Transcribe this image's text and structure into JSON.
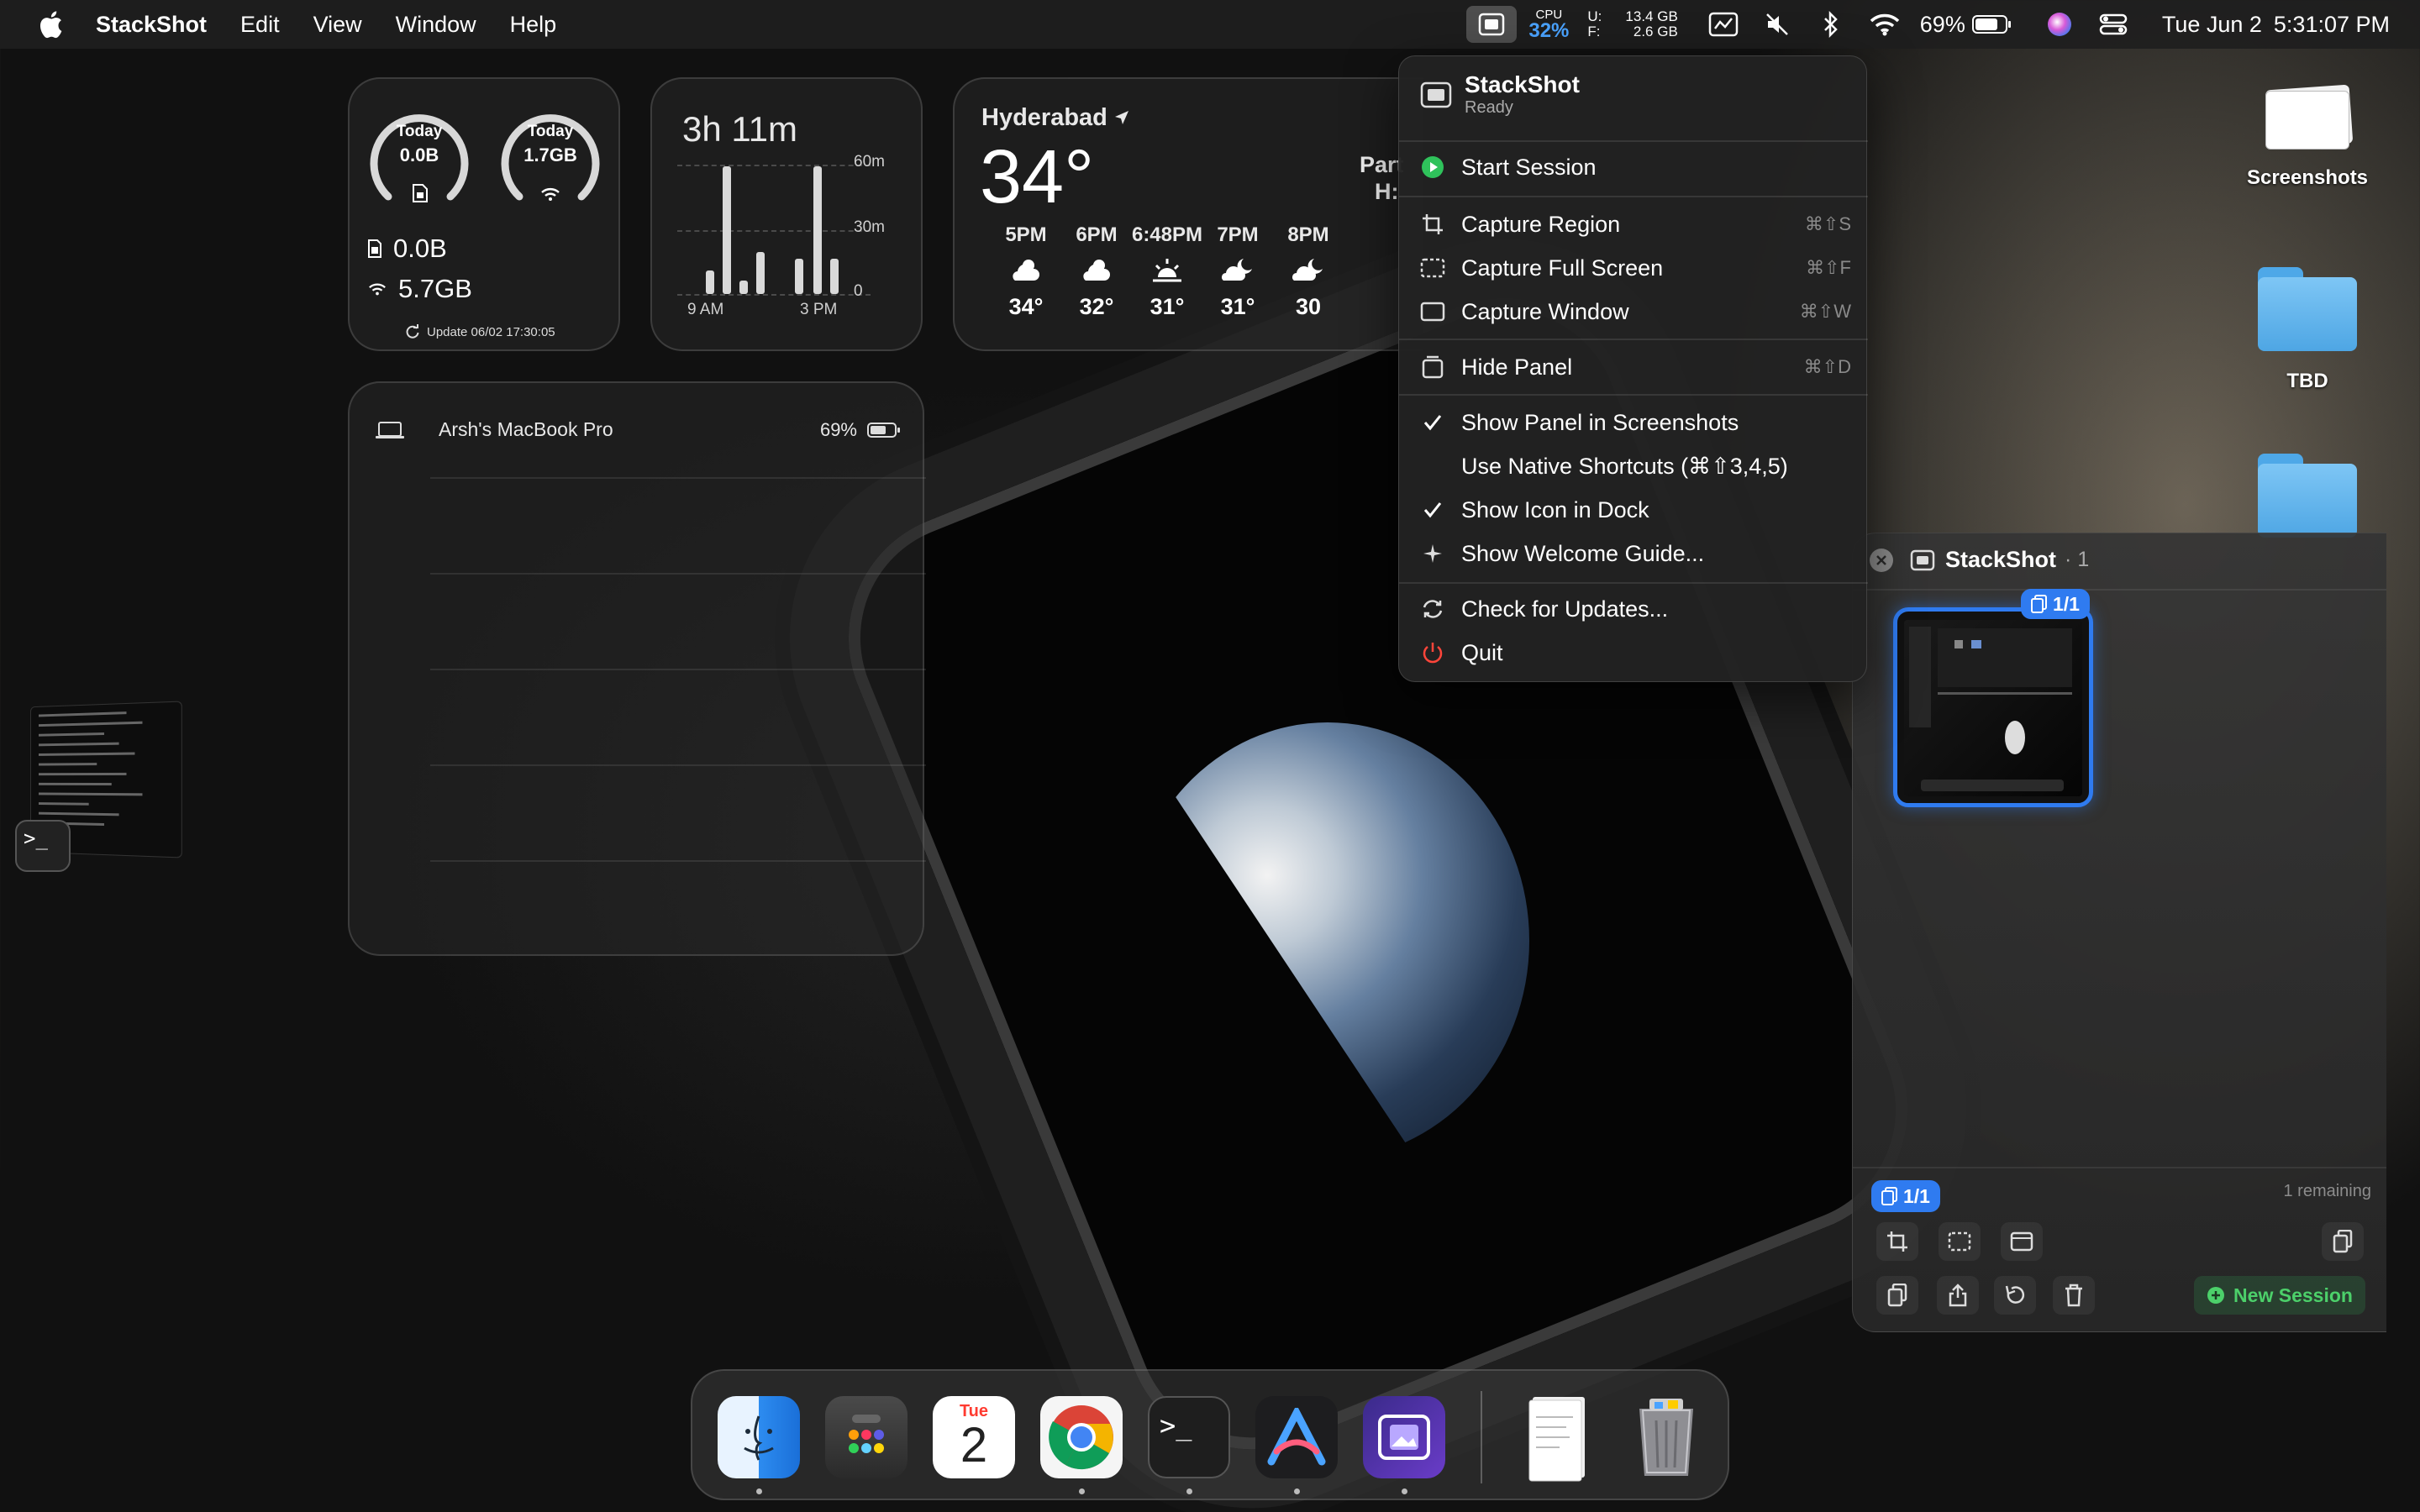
{
  "menubar": {
    "app_name": "StackShot",
    "menus": [
      "Edit",
      "View",
      "Window",
      "Help"
    ],
    "cpu_label": "CPU",
    "cpu_value": "32%",
    "mem_labels": [
      "U:",
      "F:"
    ],
    "mem_values": [
      "13.4 GB",
      "2.6 GB"
    ],
    "battery_pct": "69%",
    "date": "Tue Jun 2",
    "time": "5:31:07 PM",
    "accent": "#4aa3ff"
  },
  "widgets": {
    "data": {
      "left_ring": {
        "label": "Today",
        "value": "0.0B"
      },
      "right_ring": {
        "label": "Today",
        "value": "1.7GB"
      },
      "cellular": "0.0B",
      "wifi": "5.7GB",
      "update": "Update 06/02 17:30:05"
    },
    "screen_time": {
      "total": "3h 11m",
      "y_labels": [
        "60m",
        "30m",
        "0"
      ],
      "x_labels": [
        "9 AM",
        "3 PM"
      ]
    },
    "weather": {
      "city": "Hyderabad",
      "temp": "34°",
      "condition_line1": "Part",
      "condition_line2": "H:",
      "hours": [
        {
          "time": "5PM",
          "temp": "34°",
          "icon": "partly-sunny-icon"
        },
        {
          "time": "6PM",
          "temp": "32°",
          "icon": "partly-sunny-icon"
        },
        {
          "time": "6:48PM",
          "temp": "31°",
          "icon": "sunset-icon"
        },
        {
          "time": "7PM",
          "temp": "31°",
          "icon": "cloud-moon-icon"
        },
        {
          "time": "8PM",
          "temp": "30",
          "icon": "cloud-moon-icon"
        }
      ]
    },
    "battery": {
      "device": "Arsh's MacBook Pro",
      "pct": "69%"
    }
  },
  "desktop": {
    "items": [
      "Screenshots",
      "TBD"
    ]
  },
  "menu": {
    "title": "StackShot",
    "status": "Ready",
    "items": [
      {
        "label": "Start Session",
        "shortcut": ""
      },
      {
        "label": "Capture Region",
        "shortcut": "⌘⇧S"
      },
      {
        "label": "Capture Full Screen",
        "shortcut": "⌘⇧F"
      },
      {
        "label": "Capture Window",
        "shortcut": "⌘⇧W"
      },
      {
        "label": "Hide Panel",
        "shortcut": "⌘⇧D"
      },
      {
        "label": "Show Panel in Screenshots",
        "shortcut": ""
      },
      {
        "label": "Use Native Shortcuts (⌘⇧3,4,5)",
        "shortcut": ""
      },
      {
        "label": "Show Icon in Dock",
        "shortcut": ""
      },
      {
        "label": "Show Welcome Guide...",
        "shortcut": ""
      },
      {
        "label": "Check for Updates...",
        "shortcut": ""
      },
      {
        "label": "Quit",
        "shortcut": ""
      }
    ]
  },
  "panel": {
    "title": "StackShot",
    "count": "· 1",
    "thumb_badge": "1/1",
    "stack_badge": "1/1",
    "remaining": "1 remaining",
    "new_session": "New Session"
  },
  "dock": {
    "calendar_day": "Tue",
    "calendar_date": "2",
    "terminal_prompt": ">_"
  },
  "mini_terminal": {
    "prompt": ">_"
  }
}
